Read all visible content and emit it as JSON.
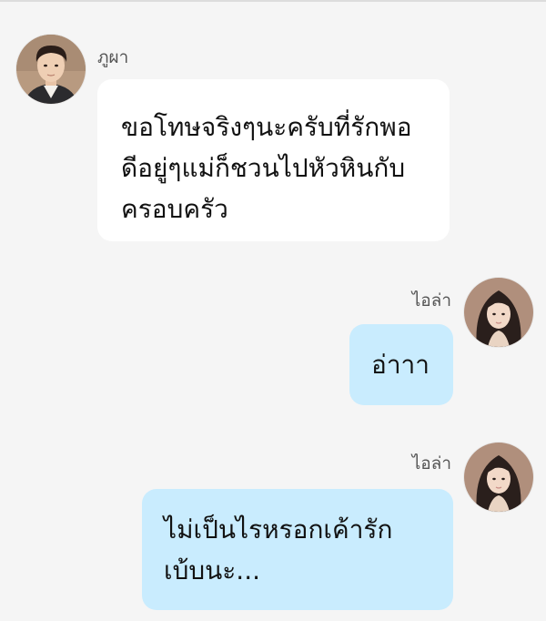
{
  "theme": {
    "background": "#f5f5f5",
    "incoming_bubble": "#ffffff",
    "outgoing_bubble": "#c9ecfe"
  },
  "messages": [
    {
      "sender": "ภูผา",
      "direction": "incoming",
      "avatar": "man-avatar",
      "lines": [
        "ขอโทษจริงๆนะครับที่รักพอ",
        "ดีอยู่ๆแม่ก็ชวนไปหัวหินกับ",
        "ครอบครัว"
      ]
    },
    {
      "sender": "ไอล่า",
      "direction": "outgoing",
      "avatar": "woman-avatar",
      "lines": [
        "อ่าาา"
      ]
    },
    {
      "sender": "ไอล่า",
      "direction": "outgoing",
      "avatar": "woman-avatar",
      "lines": [
        "ไม่เป็นไรหรอกเค้ารัก",
        "เบ้บนะ..."
      ]
    }
  ]
}
